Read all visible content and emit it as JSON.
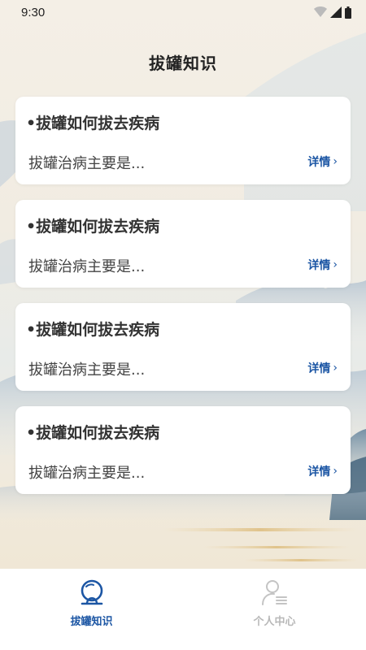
{
  "status_bar": {
    "time": "9:30"
  },
  "header": {
    "title": "拔罐知识"
  },
  "cards": [
    {
      "title": "•拔罐如何拔去疾病",
      "description": "拔罐治病主要是...",
      "detail_label": "详情",
      "chevron": "›"
    },
    {
      "title": "•拔罐如何拔去疾病",
      "description": "拔罐治病主要是...",
      "detail_label": "详情",
      "chevron": "›"
    },
    {
      "title": "•拔罐如何拔去疾病",
      "description": "拔罐治病主要是...",
      "detail_label": "详情",
      "chevron": "›"
    },
    {
      "title": "•拔罐如何拔去疾病",
      "description": "拔罐治病主要是...",
      "detail_label": "详情",
      "chevron": "›"
    }
  ],
  "tab_bar": {
    "tabs": [
      {
        "label": "拔罐知识",
        "icon": "cupping-icon",
        "active": true
      },
      {
        "label": "个人中心",
        "icon": "user-profile-icon",
        "active": false
      }
    ]
  },
  "colors": {
    "accent": "#1c56a4",
    "inactive": "#b8b8b8"
  }
}
